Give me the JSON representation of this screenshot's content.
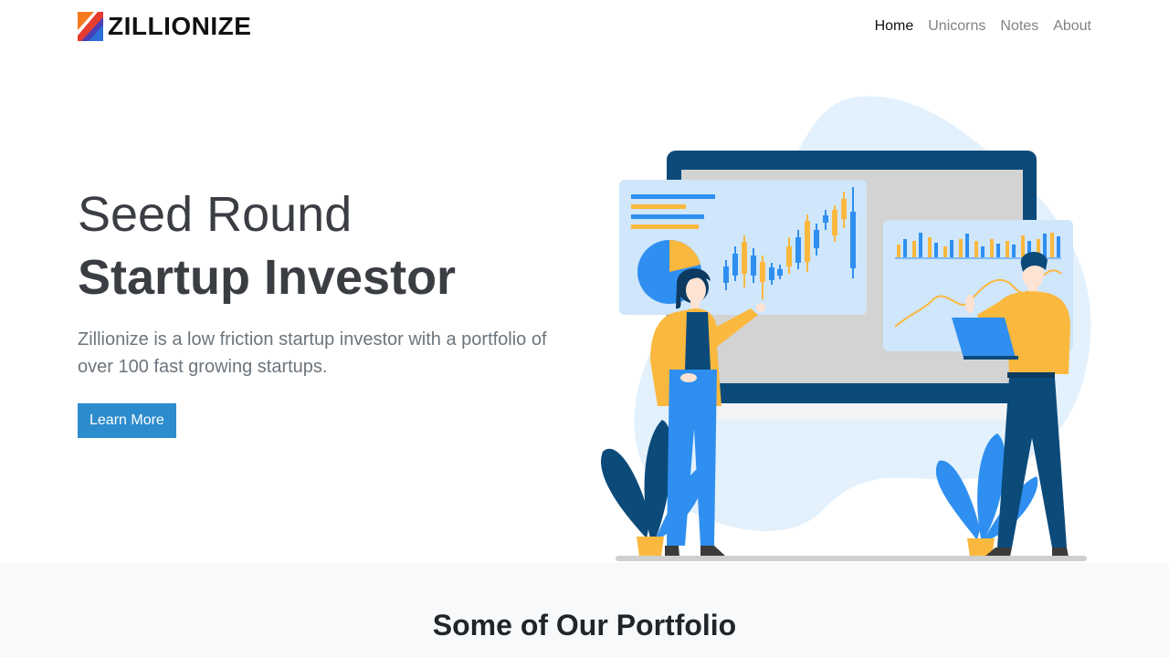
{
  "brand": {
    "name": "ZILLIONIZE",
    "colors": {
      "orange": "#f47b20",
      "blue": "#2b6fd6",
      "red": "#e63c2e"
    }
  },
  "nav": {
    "items": [
      {
        "label": "Home",
        "active": true
      },
      {
        "label": "Unicorns",
        "active": false
      },
      {
        "label": "Notes",
        "active": false
      },
      {
        "label": "About",
        "active": false
      }
    ]
  },
  "hero": {
    "title_line1": "Seed Round",
    "title_line2": "Startup Investor",
    "lead": "Zillionize is a low friction startup investor with a portfolio of over 100 fast growing startups.",
    "cta_label": "Learn More"
  },
  "illustration": {
    "icon": "investors-presentation-illustration",
    "colors": {
      "primary_blue": "#2f8ff0",
      "dark_blue": "#0c4a7a",
      "yellow": "#fbb83e",
      "light_blue": "#e3f1fd"
    }
  },
  "portfolio": {
    "heading": "Some of Our Portfolio"
  },
  "colors": {
    "button": "#2d8ccd",
    "section_bg": "#f8f9fa"
  }
}
